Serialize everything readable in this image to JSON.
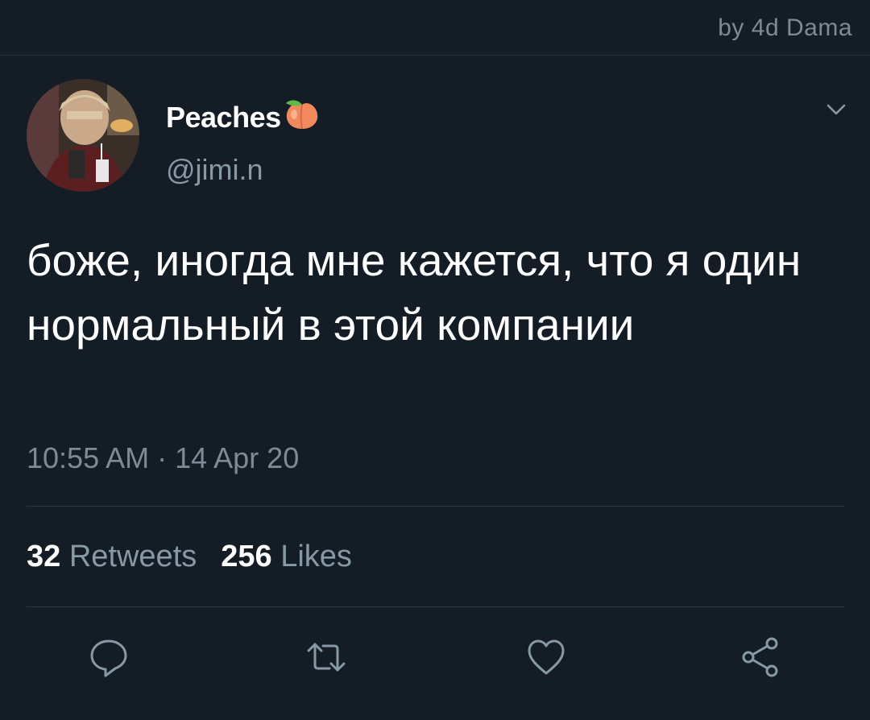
{
  "watermark": "by 4d Dama",
  "tweet": {
    "display_name": "Peaches",
    "name_emoji": "peach-icon",
    "handle": "@jimi.n",
    "text": "боже, иногда мне кажется, что я один нормальный в этой компании",
    "timestamp": "10:55 AM · 14 Apr 20",
    "retweets": {
      "count": "32",
      "label": "Retweets"
    },
    "likes": {
      "count": "256",
      "label": "Likes"
    }
  },
  "actions": [
    "reply-icon",
    "retweet-icon",
    "like-icon",
    "share-icon"
  ],
  "colors": {
    "background": "#141d26",
    "secondary_text": "#8899a6",
    "divider": "#2a3744",
    "peach": "#f08a5d"
  }
}
